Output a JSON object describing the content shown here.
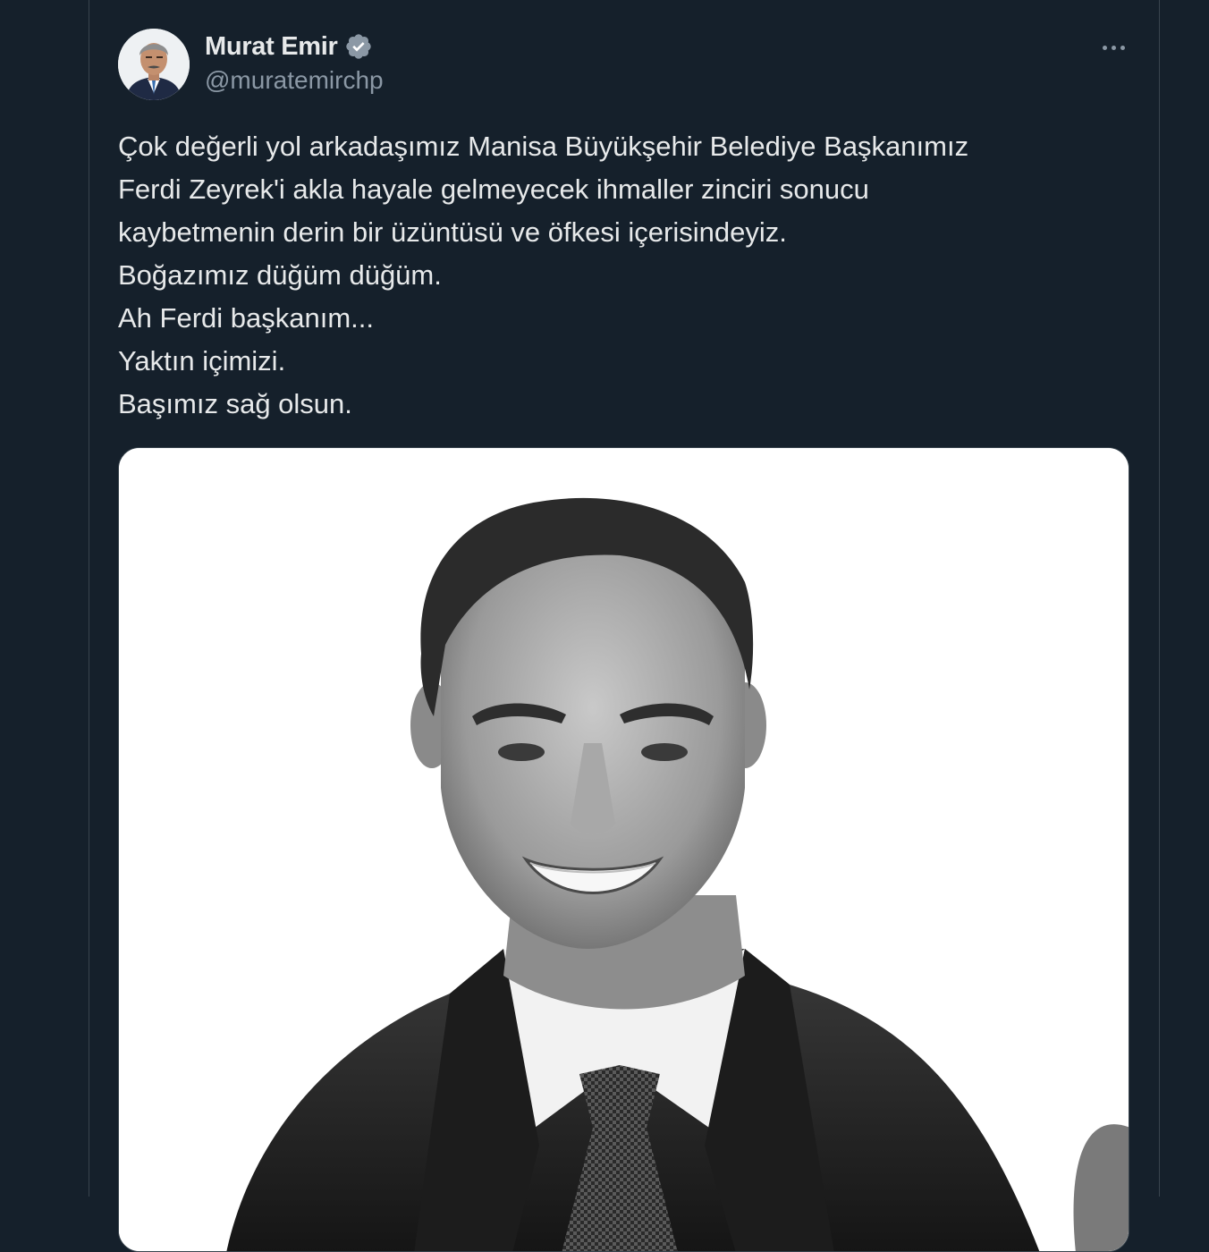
{
  "author": {
    "display_name": "Murat Emir",
    "handle": "@muratemirchp",
    "verified": true,
    "avatar_icon": "user-avatar-photo"
  },
  "tweet": {
    "text_lines": [
      "Çok değerli yol arkadaşımız Manisa Büyükşehir Belediye Başkanımız",
      "Ferdi Zeyrek'i akla hayale gelmeyecek ihmaller zinciri sonucu",
      "kaybetmenin derin bir üzüntüsü ve öfkesi içerisindeyiz.",
      "Boğazımız düğüm düğüm.",
      "Ah Ferdi başkanım...",
      "Yaktın içimizi.",
      "Başımız sağ olsun."
    ],
    "media": {
      "type": "photo",
      "description_icon": "portrait-photo"
    }
  },
  "icons": {
    "verified": "verified-badge-icon",
    "more": "more-options-icon"
  },
  "colors": {
    "background": "#15202b",
    "text_primary": "#e7e9ea",
    "text_secondary": "#8b98a5",
    "border": "#38444d",
    "verified": "#8b98a5"
  }
}
